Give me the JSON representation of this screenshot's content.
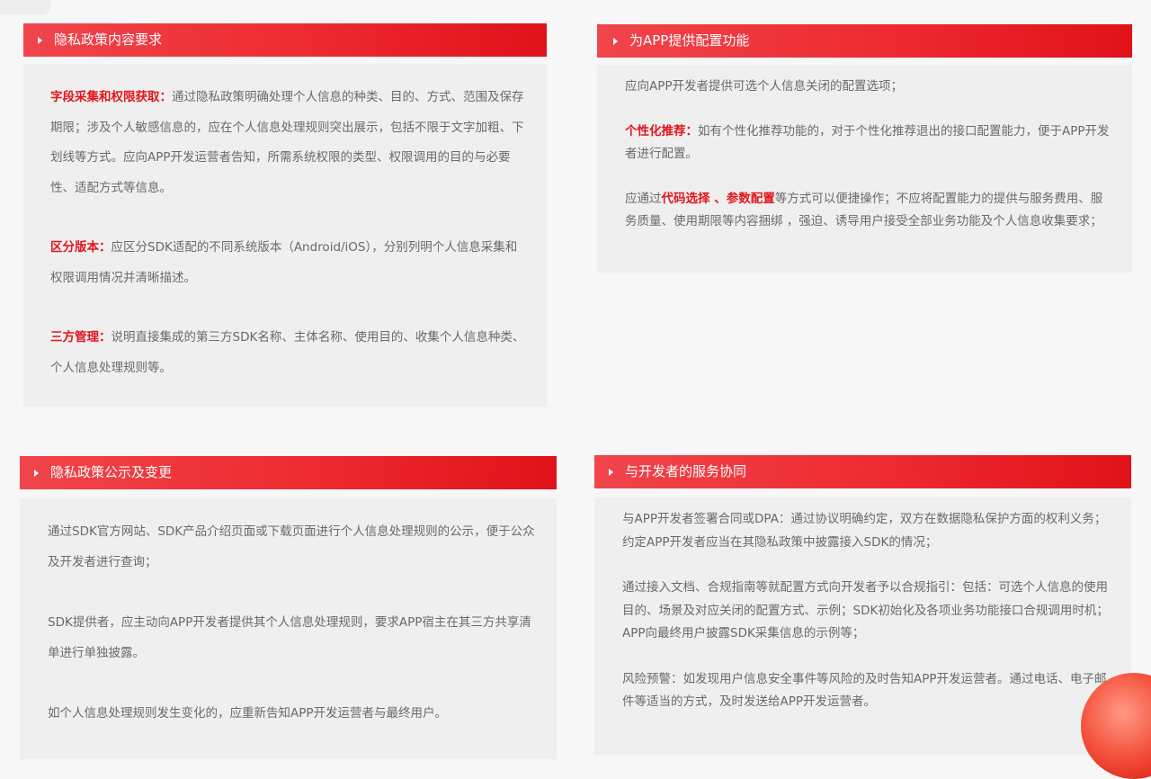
{
  "cards": [
    {
      "title": "隐私政策内容要求",
      "paragraphs": [
        {
          "label": "字段采集和权限获取：",
          "text": "通过隐私政策明确处理个人信息的种类、目的、方式、范围及保存期限；涉及个人敏感信息的，应在个人信息处理规则突出展示，包括不限于文字加粗、下划线等方式。应向APP开发运营者告知，所需系统权限的类型、权限调用的目的与必要性、适配方式等信息。"
        },
        {
          "label": "区分版本：",
          "text": "应区分SDK适配的不同系统版本（Android/iOS），分别列明个人信息采集和权限调用情况并清晰描述。"
        },
        {
          "label": "三方管理：",
          "text": "说明直接集成的第三方SDK名称、主体名称、使用目的、收集个人信息种类、个人信息处理规则等。"
        }
      ]
    },
    {
      "title": "为APP提供配置功能",
      "paragraphs": [
        {
          "text": "应向APP开发者提供可选个人信息关闭的配置选项；"
        },
        {
          "label": "个性化推荐：",
          "text": "如有个性化推荐功能的，对于个性化推荐退出的接口配置能力，便于APP开发者进行配置。"
        },
        {
          "prefix": "应通过",
          "label": "代码选择 、参数配置",
          "text": "等方式可以便捷操作；不应将配置能力的提供与服务费用、服务质量、使用期限等内容捆绑 ，强迫、诱导用户接受全部业务功能及个人信息收集要求；"
        }
      ]
    },
    {
      "title": "隐私政策公示及变更",
      "paragraphs": [
        {
          "text": "通过SDK官方网站、SDK产品介绍页面或下载页面进行个人信息处理规则的公示，便于公众及开发者进行查询；"
        },
        {
          "text": "SDK提供者，应主动向APP开发者提供其个人信息处理规则，要求APP宿主在其三方共享清单进行单独披露。"
        },
        {
          "text": "如个人信息处理规则发生变化的，应重新告知APP开发运营者与最终用户。"
        }
      ]
    },
    {
      "title": "与开发者的服务协同",
      "paragraphs": [
        {
          "text": "与APP开发者签署合同或DPA：通过协议明确约定，双方在数据隐私保护方面的权利义务；约定APP开发者应当在其隐私政策中披露接入SDK的情况；"
        },
        {
          "text": "通过接入文档、合规指南等就配置方式向开发者予以合规指引：包括：可选个人信息的使用目的、场景及对应关闭的配置方式、示例；SDK初始化及各项业务功能接口合规调用时机；APP向最终用户披露SDK采集信息的示例等；"
        },
        {
          "text": "风险预警：如发现用户信息安全事件等风险的及时告知APP开发运营者。通过电话、电子邮件等适当的方式，及时发送给APP开发运营者。"
        }
      ]
    }
  ]
}
